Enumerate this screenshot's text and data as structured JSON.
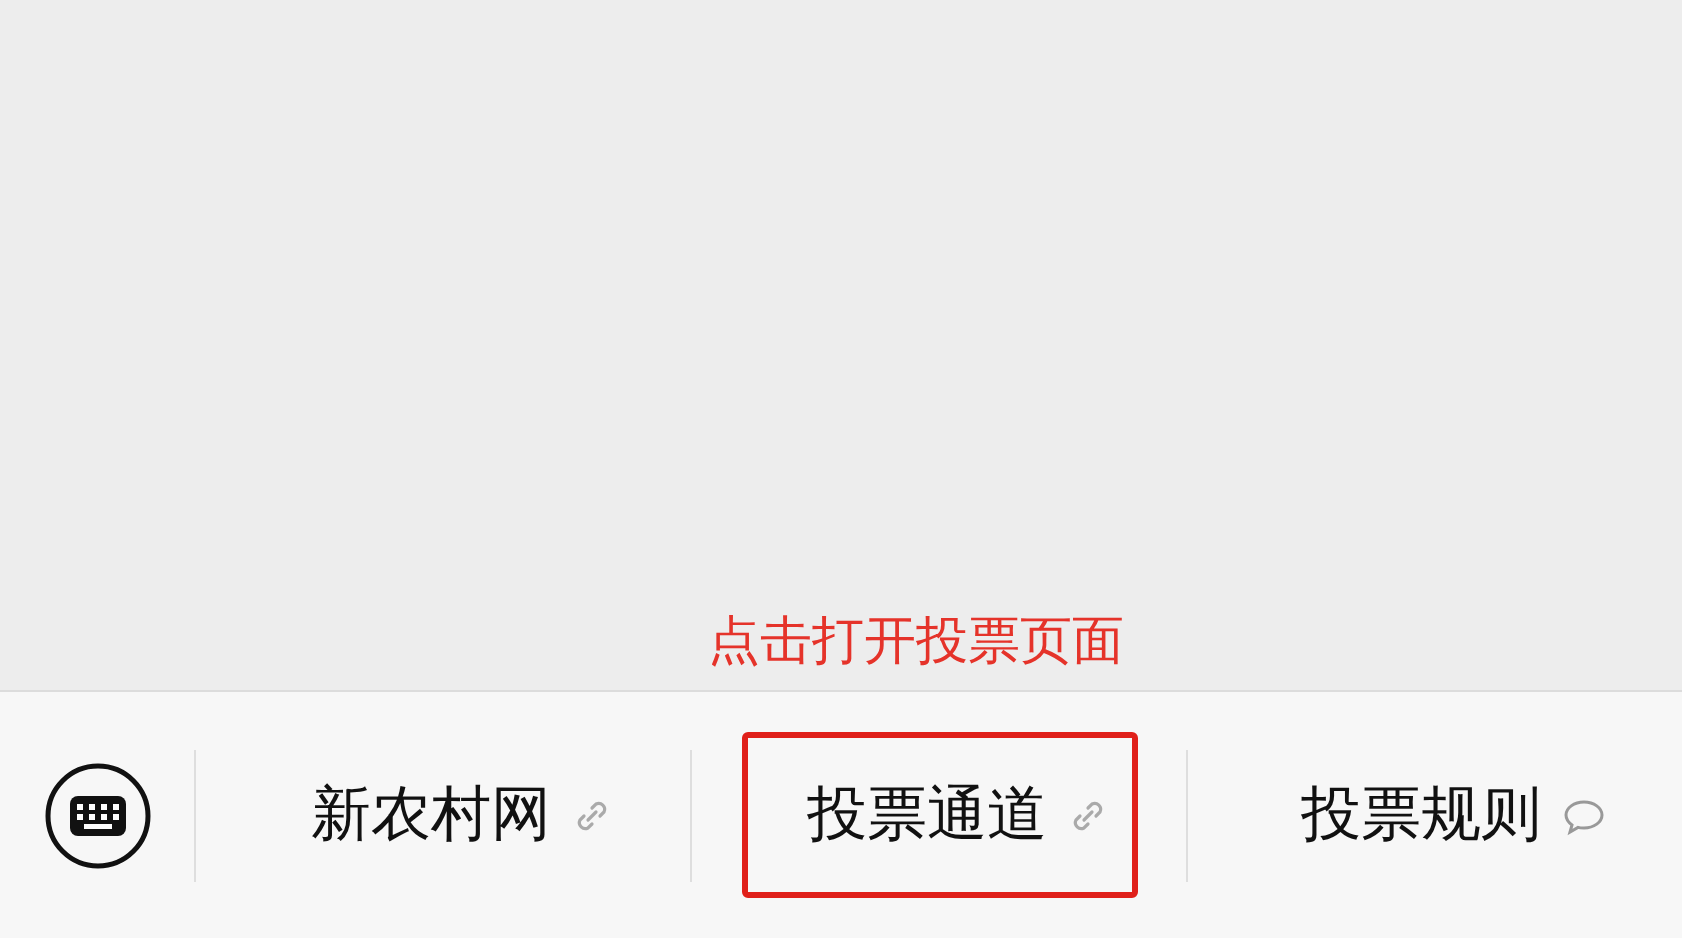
{
  "annotation": {
    "text": "点击打开投票页面"
  },
  "menu": [
    {
      "label": "新农村网",
      "kind": "link",
      "highlighted": false
    },
    {
      "label": "投票通道",
      "kind": "link",
      "highlighted": true
    },
    {
      "label": "投票规则",
      "kind": "message",
      "highlighted": false
    }
  ]
}
